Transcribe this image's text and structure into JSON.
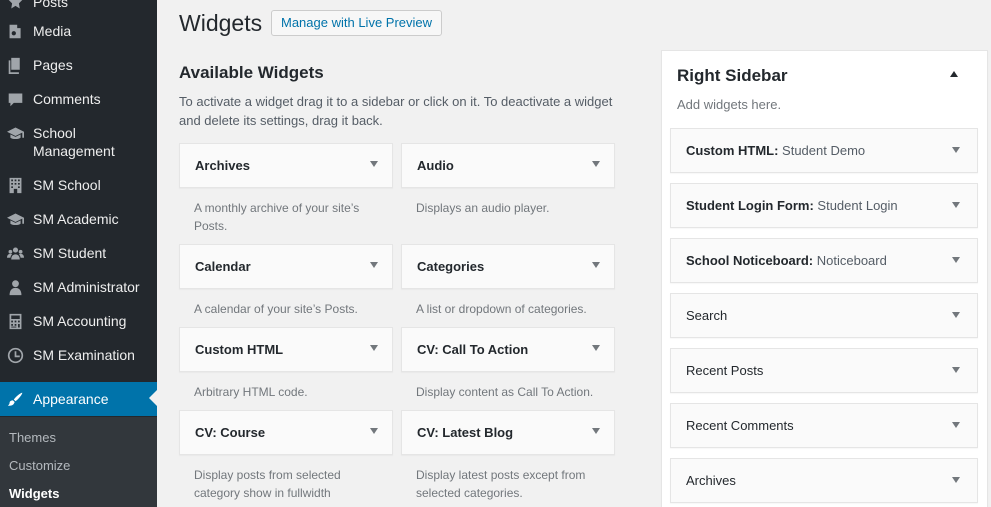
{
  "admin_menu": {
    "items": [
      {
        "label": "Posts",
        "icon": "pin-icon"
      },
      {
        "label": "Media",
        "icon": "media-icon"
      },
      {
        "label": "Pages",
        "icon": "pages-icon"
      },
      {
        "label": "Comments",
        "icon": "comments-icon"
      },
      {
        "label": "School Management",
        "icon": "graduation-cap-icon"
      },
      {
        "label": "SM School",
        "icon": "building-icon"
      },
      {
        "label": "SM Academic",
        "icon": "graduation-cap-icon"
      },
      {
        "label": "SM Student",
        "icon": "groups-icon"
      },
      {
        "label": "SM Administrator",
        "icon": "user-icon"
      },
      {
        "label": "SM Accounting",
        "icon": "calculator-icon"
      },
      {
        "label": "SM Examination",
        "icon": "clock-icon"
      },
      {
        "label": "Appearance",
        "icon": "paintbrush-icon"
      }
    ],
    "submenu": [
      {
        "label": "Themes"
      },
      {
        "label": "Customize"
      },
      {
        "label": "Widgets"
      }
    ]
  },
  "header": {
    "title": "Widgets",
    "action_label": "Manage with Live Preview"
  },
  "available": {
    "title": "Available Widgets",
    "description": "To activate a widget drag it to a sidebar or click on it. To deactivate a widget and delete its settings, drag it back.",
    "widgets": [
      {
        "title": "Archives",
        "desc": "A monthly archive of your site’s Posts."
      },
      {
        "title": "Audio",
        "desc": "Displays an audio player."
      },
      {
        "title": "Calendar",
        "desc": "A calendar of your site’s Posts."
      },
      {
        "title": "Categories",
        "desc": "A list or dropdown of categories."
      },
      {
        "title": "Custom HTML",
        "desc": "Arbitrary HTML code."
      },
      {
        "title": "CV: Call To Action",
        "desc": "Display content as Call To Action."
      },
      {
        "title": "CV: Course",
        "desc": "Display posts from selected category show in fullwidth"
      },
      {
        "title": "CV: Latest Blog",
        "desc": "Display latest posts except from selected categories."
      }
    ]
  },
  "right_sidebar": {
    "title": "Right Sidebar",
    "description": "Add widgets here.",
    "widgets": [
      {
        "type": "Custom HTML:",
        "instance": " Student Demo"
      },
      {
        "type": "Student Login Form:",
        "instance": " Student Login"
      },
      {
        "type": "School Noticeboard:",
        "instance": " Noticeboard"
      },
      {
        "type": "Search",
        "instance": ""
      },
      {
        "type": "Recent Posts",
        "instance": ""
      },
      {
        "type": "Recent Comments",
        "instance": ""
      },
      {
        "type": "Archives",
        "instance": ""
      }
    ]
  },
  "colors": {
    "sidebar_bg": "#23282d",
    "submenu_bg": "#32373c",
    "accent": "#0073aa",
    "page_bg": "#f1f1f1"
  }
}
